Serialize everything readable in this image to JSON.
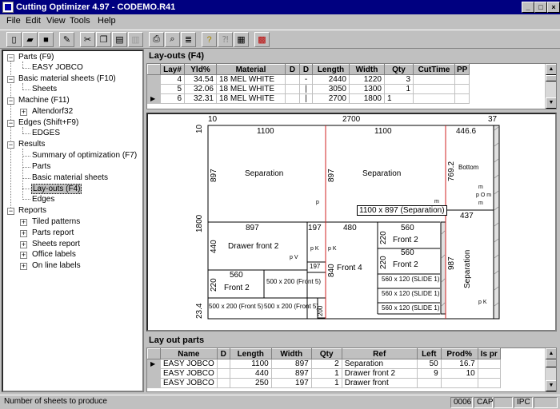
{
  "window": {
    "title": "Cutting Optimizer 4.97 - CODEMO.R41"
  },
  "menu": [
    "File",
    "Edit",
    "View",
    "Tools",
    "Help"
  ],
  "tree": {
    "parts": "Parts (F9)",
    "parts_child": "EASY JOBCO",
    "sheets": "Basic material sheets (F10)",
    "sheets_child": "Sheets",
    "machine": "Machine (F11)",
    "machine_child": "Altendorf32",
    "edges": "Edges (Shift+F9)",
    "edges_child": "EDGES",
    "results": "Results",
    "results_children": [
      "Summary of optimization (F7)",
      "Parts",
      "Basic material sheets",
      "Lay-outs (F4)",
      "Edges"
    ],
    "reports": "Reports",
    "reports_children": [
      "Tiled patterns",
      "Parts report",
      "Sheets report",
      "Office labels",
      "On line labels"
    ]
  },
  "layouts": {
    "title": "Lay-outs (F4)",
    "headers": [
      "Lay#",
      "Yld%",
      "Material",
      "D",
      "D",
      "Length",
      "Width",
      "Qty",
      "CutTime",
      "PP"
    ],
    "rows": [
      [
        "4",
        "34.54",
        "18 MEL WHITE",
        "",
        "-",
        "2440",
        "1220",
        "3",
        "",
        ""
      ],
      [
        "5",
        "32.06",
        "18 MEL WHITE",
        "",
        "|",
        "3050",
        "1300",
        "1",
        "",
        ""
      ],
      [
        "6",
        "32.31",
        "18 MEL WHITE",
        "",
        "|",
        "2700",
        "1800",
        "1",
        "",
        ""
      ]
    ]
  },
  "diagram": {
    "top_left_trim": "10",
    "sheet_length": "2700",
    "top_right_trim": "37",
    "sheet_width": "1800",
    "left_top_trim": "10",
    "bottom_trim": "23.4",
    "labels": {
      "a_w": "1100",
      "a_h": "897",
      "a_name": "Separation",
      "b_w": "1100",
      "b_h": "897",
      "b_name": "Separation",
      "c_w": "446.6",
      "c_h": "769.2",
      "c_name": "Bottom",
      "tooltip": "1100 x 897 (Separation)",
      "d_w": "897",
      "d_h": "440",
      "d_name": "Drawer front 2",
      "e_w": "197",
      "e_box": "197",
      "f_w": "480",
      "f_h": "840",
      "f_name": "Front 4",
      "g_w": "560",
      "g_h": "220",
      "g_name": "Front 2",
      "h_w": "560",
      "h_h": "220",
      "h_name": "Front 2",
      "i_w": "437",
      "i_h": "987",
      "i_name": "Separation",
      "j_w": "560",
      "j_h": "220",
      "j_name": "Front 2",
      "k1": "500 x 200 (Front 5)",
      "k2": "500 x 200 (Front 5)",
      "k3": "500 x 200 (Front 5)",
      "k_v": "200",
      "slide1": "560 x 120 (SLIDE 1)",
      "slide2": "560 x 120 (SLIDE 1)",
      "slide3": "560 x 120 (SLIDE 1)",
      "p_mark": "p",
      "m_mark": "m",
      "pk1": "p K",
      "pk2": "p K",
      "pv": "p V",
      "pom": "p O m",
      "pk3": "p K"
    }
  },
  "layout_parts": {
    "title": "Lay out parts",
    "headers": [
      "Name",
      "D",
      "Length",
      "Width",
      "Qty",
      "Ref",
      "Left",
      "Prod%",
      "Is pr"
    ],
    "rows": [
      [
        "EASY JOBCO",
        "",
        "1100",
        "897",
        "2",
        "Separation",
        "50",
        "16.7",
        ""
      ],
      [
        "EASY JOBCO",
        "",
        "440",
        "897",
        "1",
        "Drawer front 2",
        "9",
        "10",
        ""
      ],
      [
        "EASY JOBCO",
        "",
        "250",
        "197",
        "1",
        "Drawer front",
        "",
        "",
        ""
      ]
    ]
  },
  "status": {
    "message": "Number of sheets to produce",
    "code": "0006",
    "caps": "CAP",
    "ipc": "IPC"
  }
}
